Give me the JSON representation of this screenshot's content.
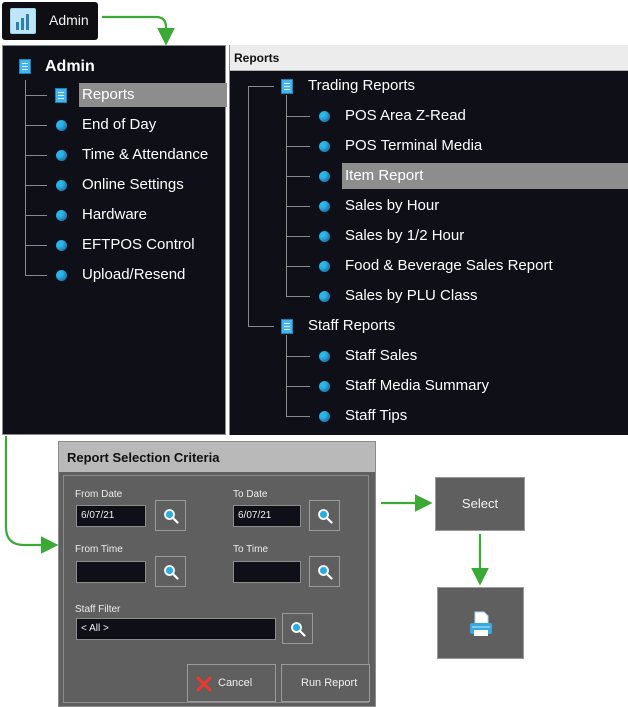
{
  "admin_button": {
    "label": "Admin",
    "icon": "bar-chart-icon"
  },
  "admin_panel": {
    "root_label": "Admin",
    "items": [
      {
        "label": "Reports",
        "icon": "document-icon",
        "selected": true
      },
      {
        "label": "End of Day",
        "icon": "blue-dot-icon"
      },
      {
        "label": "Time & Attendance",
        "icon": "blue-dot-icon"
      },
      {
        "label": "Online Settings",
        "icon": "blue-dot-icon"
      },
      {
        "label": "Hardware",
        "icon": "blue-dot-icon"
      },
      {
        "label": "EFTPOS Control",
        "icon": "blue-dot-icon"
      },
      {
        "label": "Upload/Resend",
        "icon": "blue-dot-icon"
      }
    ]
  },
  "reports_panel": {
    "title": "Reports",
    "groups": [
      {
        "label": "Trading Reports",
        "icon": "document-icon",
        "items": [
          {
            "label": "POS Area Z-Read"
          },
          {
            "label": "POS Terminal Media"
          },
          {
            "label": "Item Report",
            "selected": true
          },
          {
            "label": "Sales by Hour"
          },
          {
            "label": "Sales by 1/2 Hour"
          },
          {
            "label": "Food & Beverage Sales Report"
          },
          {
            "label": "Sales by PLU Class"
          }
        ]
      },
      {
        "label": "Staff Reports",
        "icon": "document-icon",
        "items": [
          {
            "label": "Staff Sales"
          },
          {
            "label": "Staff Media Summary"
          },
          {
            "label": "Staff Tips"
          }
        ]
      }
    ]
  },
  "criteria_dialog": {
    "title": "Report Selection Criteria",
    "from_date_label": "From Date",
    "from_date_value": "6/07/21",
    "to_date_label": "To Date",
    "to_date_value": "6/07/21",
    "from_time_label": "From Time",
    "from_time_value": "",
    "to_time_label": "To Time",
    "to_time_value": "",
    "staff_filter_label": "Staff Filter",
    "staff_filter_value": "< All >",
    "cancel_label": "Cancel",
    "run_report_label": "Run Report"
  },
  "select_button": {
    "label": "Select"
  },
  "print_button": {
    "icon": "printer-icon"
  },
  "colors": {
    "panel_bg": "#0f0f17",
    "accent_blue": "#2cb7ea",
    "selection": "#8d8d8d",
    "arrow_green": "#3aa935",
    "dialog_bg": "#5f5f5f"
  }
}
